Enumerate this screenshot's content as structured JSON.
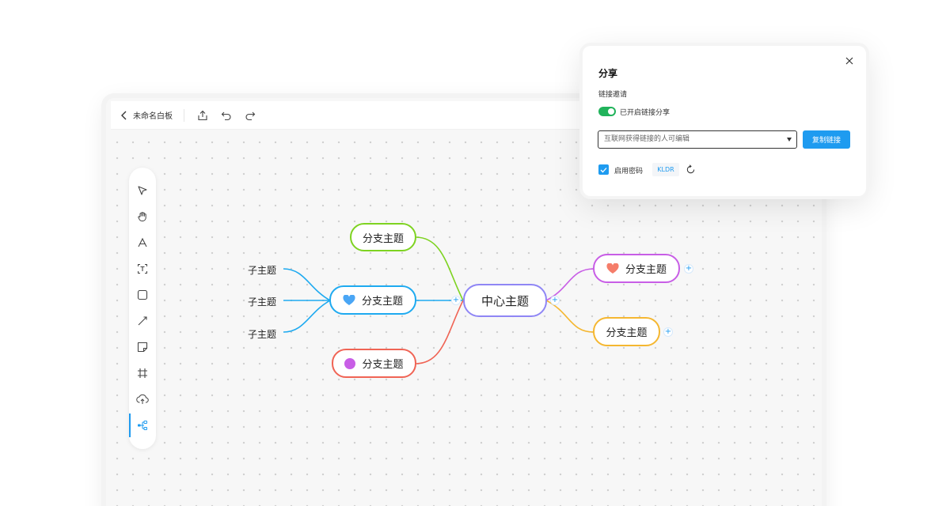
{
  "topbar": {
    "title": "未命名白板"
  },
  "toolbar": {
    "tools": [
      "select-icon",
      "hand-icon",
      "pen-icon",
      "text-icon",
      "rectangle-icon",
      "line-icon",
      "sticky-note-icon",
      "frame-icon",
      "upload-icon",
      "mindmap-icon"
    ],
    "active_tool": "mindmap-icon"
  },
  "mindmap": {
    "center": "中心主题",
    "branches": [
      {
        "label": "分支主题",
        "color": "#7ed321"
      },
      {
        "label": "分支主题",
        "color": "#1eaaf0",
        "icon": "heart-icon"
      },
      {
        "label": "分支主题",
        "color": "#f06455",
        "icon": "dot-icon"
      },
      {
        "label": "分支主题",
        "color": "#c85ee6",
        "icon": "heart-icon"
      },
      {
        "label": "分支主题",
        "color": "#f5b731"
      }
    ],
    "subtopics": [
      "子主题",
      "子主题",
      "子主题"
    ],
    "plus": "+"
  },
  "share": {
    "title": "分享",
    "subtitle": "链接邀请",
    "toggle_label": "已开启链接分享",
    "select_value": "互联网获得链接的人可编辑",
    "copy_button": "复制链接",
    "password_label": "启用密码",
    "password_value": "KLDR"
  },
  "colors": {
    "accent": "#1e9bf0",
    "toggle_on": "#21b35b"
  }
}
